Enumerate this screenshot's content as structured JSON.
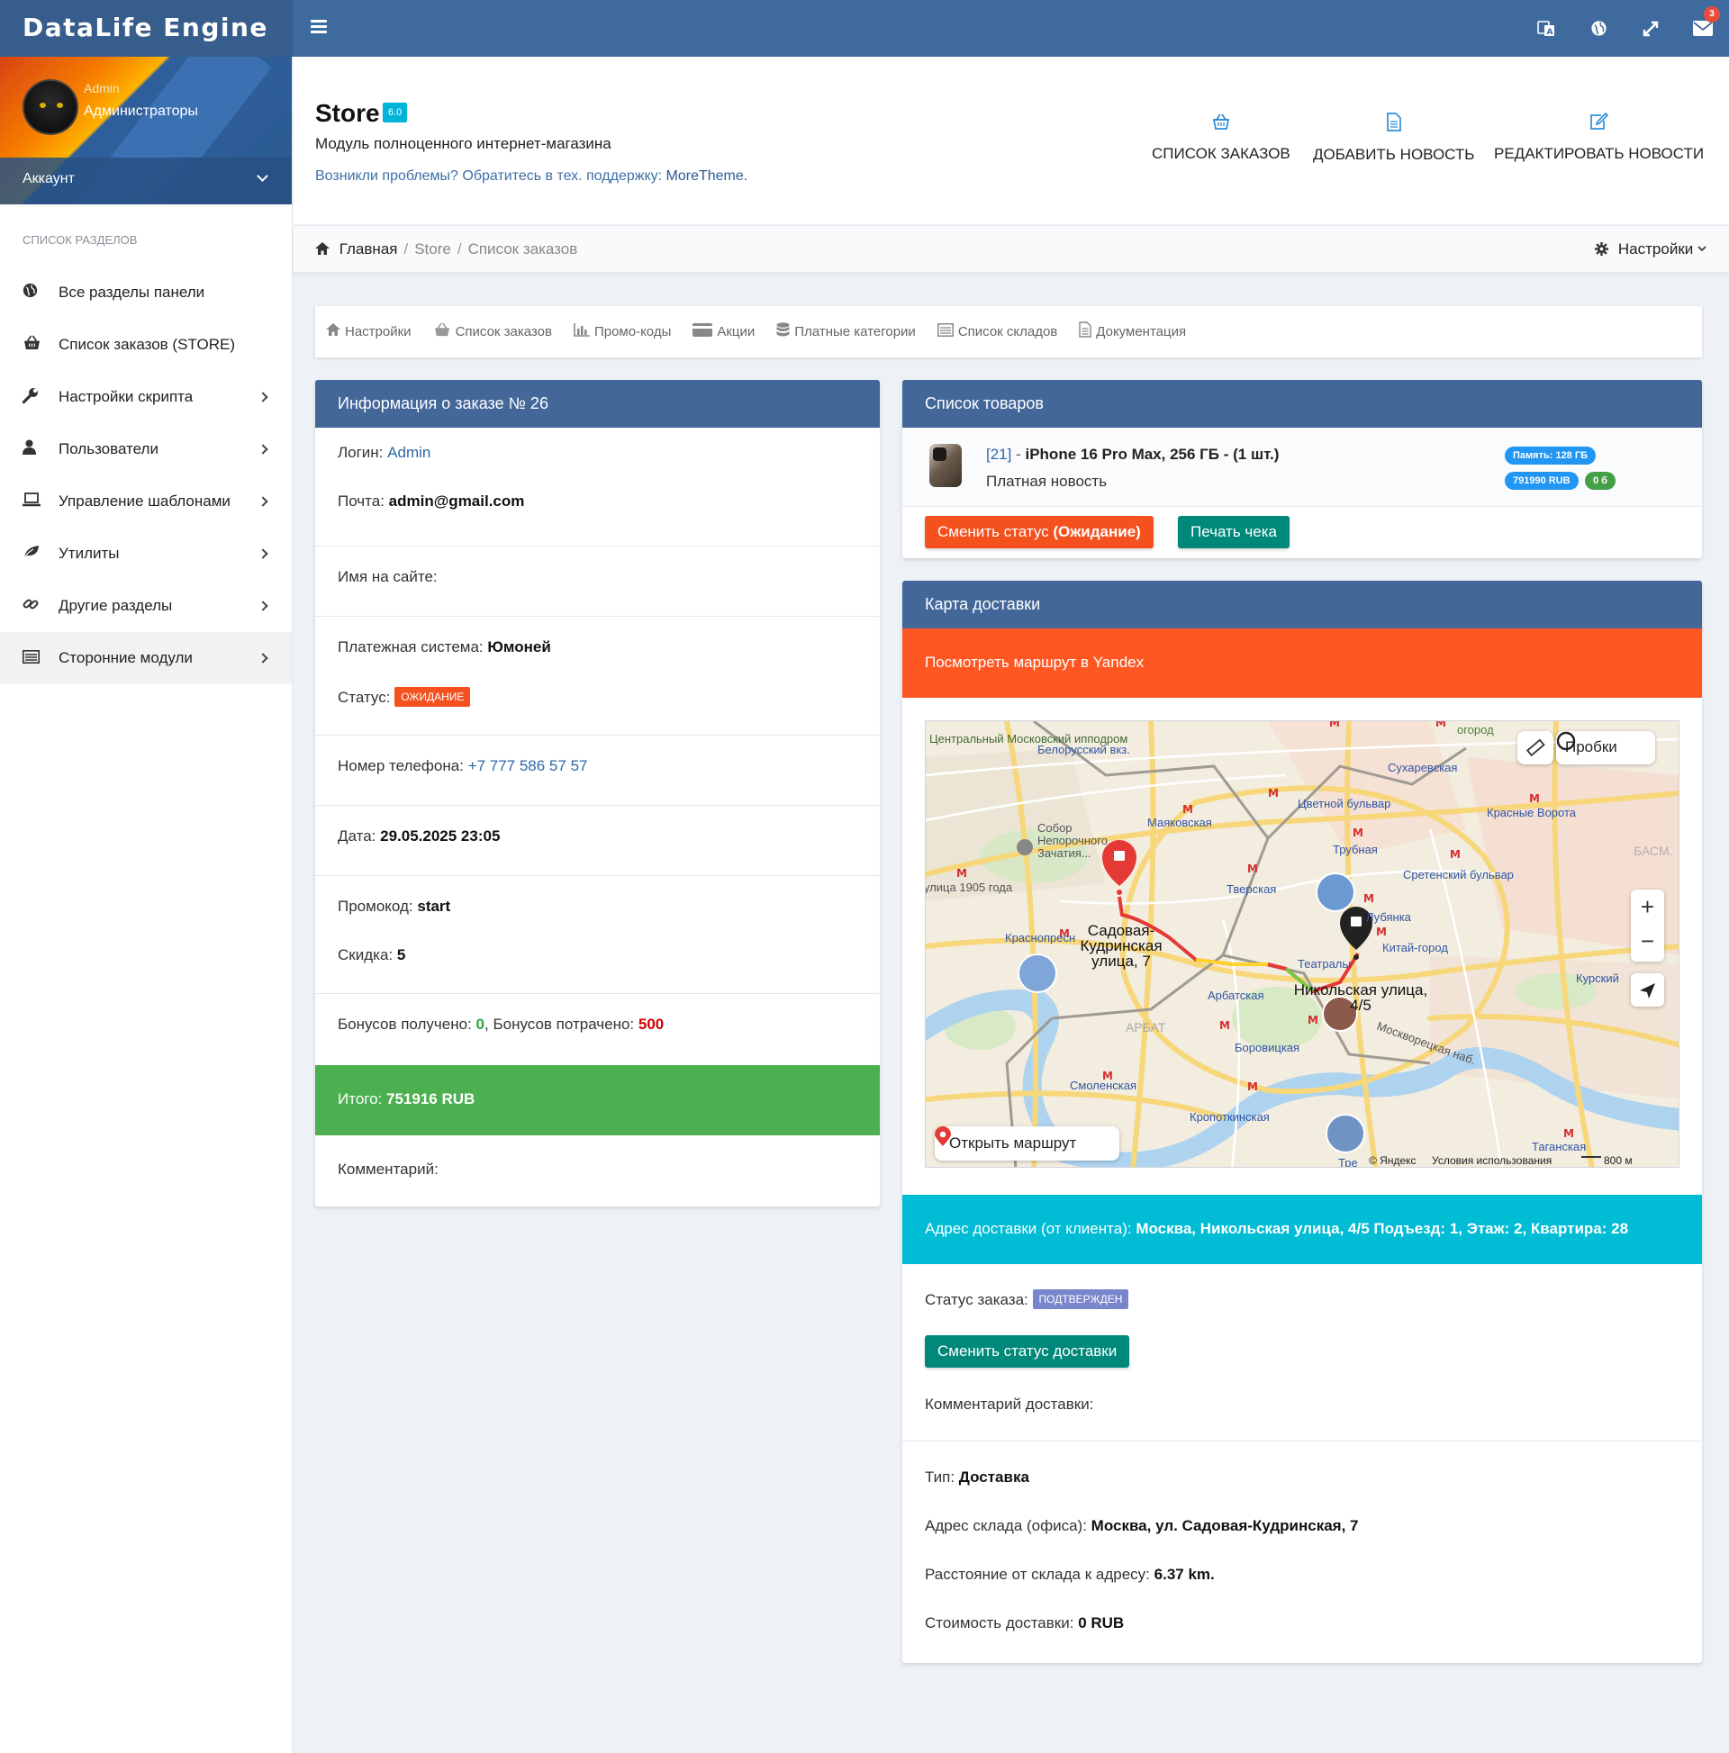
{
  "app": {
    "brand": "DataLife Engine"
  },
  "topbar": {
    "mail_count": "3",
    "icons": [
      "translate-icon",
      "globe-icon",
      "fullscreen-icon",
      "mail-icon"
    ]
  },
  "sidebar": {
    "user_name": "Admin",
    "user_group": "Администраторы",
    "account_label": "Аккаунт",
    "section_heading": "Список разделов",
    "items": [
      {
        "label": "Все разделы панели",
        "icon": "globe-icon",
        "arrow": false
      },
      {
        "label": "Список заказов (STORE)",
        "icon": "basket-icon",
        "arrow": false
      },
      {
        "label": "Настройки скрипта",
        "icon": "wrench-icon",
        "arrow": true
      },
      {
        "label": "Пользователи",
        "icon": "user-icon",
        "arrow": true
      },
      {
        "label": "Управление шаблонами",
        "icon": "laptop-icon",
        "arrow": true
      },
      {
        "label": "Утилиты",
        "icon": "leaf-icon",
        "arrow": true
      },
      {
        "label": "Другие разделы",
        "icon": "link-icon",
        "arrow": true
      },
      {
        "label": "Сторонние модули",
        "icon": "list-icon",
        "arrow": true
      }
    ]
  },
  "header": {
    "title": "Store",
    "version": "6.0",
    "subtitle": "Модуль полноценного интернет-магазина",
    "support_text": "Возникли проблемы? Обратитесь в тех. поддержку:",
    "support_link": "MoreTheme.",
    "actions": [
      {
        "label": "СПИСОК ЗАКАЗОВ",
        "icon": "basket-icon"
      },
      {
        "label": "ДОБАВИТЬ НОВОСТЬ",
        "icon": "document-icon"
      },
      {
        "label": "РЕДАКТИРОВАТЬ НОВОСТИ",
        "icon": "edit-icon"
      }
    ]
  },
  "breadcrumb": {
    "home": "Главная",
    "store": "Store",
    "current": "Список заказов",
    "settings": "Настройки"
  },
  "toolbar": {
    "items": [
      "Настройки",
      "Список заказов",
      "Промо-коды",
      "Акции",
      "Платные категории",
      "Список складов",
      "Документация"
    ]
  },
  "order": {
    "title": "Информация о заказе № 26",
    "login_label": "Логин:",
    "login_value": "Admin",
    "email_label": "Почта:",
    "email_value": "admin@gmail.com",
    "site_name_label": "Имя на сайте:",
    "payment_label": "Платежная система:",
    "payment_value": "Юмоней",
    "status_label": "Статус:",
    "status_value": "ОЖИДАНИЕ",
    "phone_label": "Номер телефона:",
    "phone_value": "+7 777 586 57 57",
    "date_label": "Дата:",
    "date_value": "29.05.2025 23:05",
    "promo_label": "Промокод:",
    "promo_value": "start",
    "discount_label": "Скидка:",
    "discount_value": "5",
    "bonus_received_label": "Бонусов получено:",
    "bonus_received_value": "0",
    "bonus_spent_label": "Бонусов потрачено:",
    "bonus_spent_value": "500",
    "total_label": "Итого:",
    "total_value": "751916 RUB",
    "comment_label": "Комментарий:"
  },
  "products": {
    "title": "Список товаров",
    "items": [
      {
        "id": "[21]",
        "name": "iPhone 16 Pro Max, 256 ГБ - (1 шт.)",
        "subtitle": "Платная новость",
        "memory_badge": "Память: 128 ГБ",
        "price_badge": "791990 RUB",
        "count_badge": "0 б"
      }
    ],
    "change_status_label": "Сменить статус",
    "change_status_value": "(Ожидание)",
    "print_label": "Печать чека"
  },
  "delivery": {
    "title": "Карта доставки",
    "route_link": "Посмотреть маршрут в Yandex",
    "map": {
      "traffic_button": "Пробки",
      "open_route_button": "Открыть маршрут",
      "origin_label": "Садовая-Кудринская улица, 7",
      "destination_label": "Никольская улица, 4/5",
      "copyright": "© Яндекс",
      "terms": "Условия использования",
      "scale": "800 м",
      "places": [
        "Центральный Московский ипподром",
        "Белорусский вкз.",
        "Сухаревская",
        "Цветной бульвар",
        "Маяковская",
        "Красные Ворота",
        "Трубная",
        "Сретенский бульвар",
        "Собор Непорочного Зачатия...",
        "Тверская",
        "Лубянка",
        "Краснопресненская",
        "Китай-город",
        "Курский",
        "Театральная",
        "Арбатская",
        "АРБАТ",
        "Боровицкая",
        "Смоленская",
        "Кропоткинская",
        "Таганская",
        "Москворецкая наб.",
        "улица 1905 года",
        "БАСМ.",
        "огород",
        "Тре"
      ]
    },
    "address_label": "Адрес доставки (от клиента):",
    "address_value": "Москва, Никольская улица, 4/5 Подъезд: 1, Этаж: 2, Квартира: 28",
    "order_status_label": "Статус заказа:",
    "order_status_value": "ПОДТВЕРЖДЕН",
    "change_delivery_status": "Сменить статус доставки",
    "delivery_comment_label": "Комментарий доставки:",
    "type_label": "Тип:",
    "type_value": "Доставка",
    "warehouse_label": "Адрес склада (офиса):",
    "warehouse_value": "Москва, ул. Садовая-Кудринская, 7",
    "distance_label": "Расстояние от склада к адресу:",
    "distance_value": "6.37 km.",
    "cost_label": "Стоимость доставки:",
    "cost_value": "0 RUB"
  },
  "colors": {
    "navbar": "#3f6a9e",
    "panel_head": "#44679a",
    "success": "#4caf50",
    "danger": "#ff5722",
    "info": "#00bcd4",
    "teal_button": "#00897b"
  }
}
